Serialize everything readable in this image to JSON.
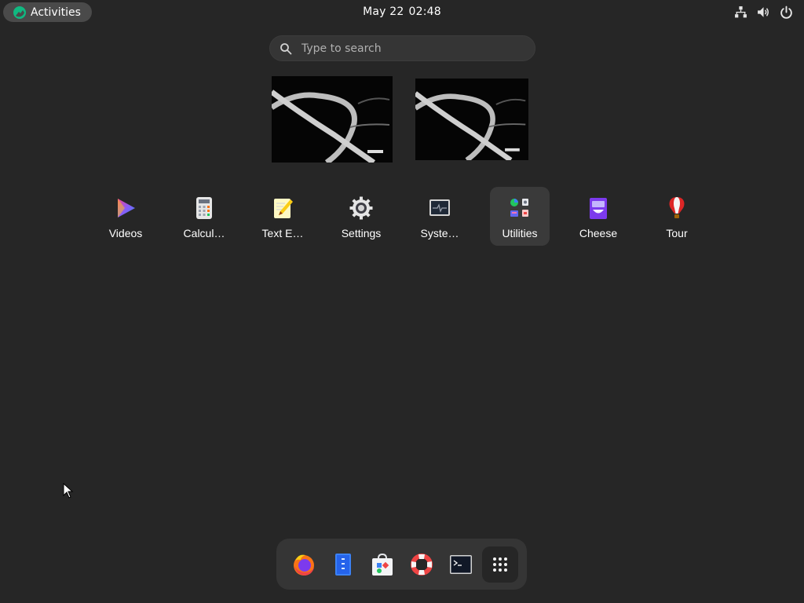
{
  "topbar": {
    "activities_label": "Activities",
    "clock_date": "May 22",
    "clock_time": "02:48",
    "tray_icons": [
      "network-wired-icon",
      "volume-icon",
      "power-icon"
    ]
  },
  "search": {
    "placeholder": "Type to search"
  },
  "workspaces": [
    {
      "name": "workspace-1"
    },
    {
      "name": "workspace-2"
    }
  ],
  "apps": [
    {
      "label": "Videos",
      "icon": "videos-icon"
    },
    {
      "label": "Calcul…",
      "icon": "calculator-icon"
    },
    {
      "label": "Text E…",
      "icon": "text-editor-icon"
    },
    {
      "label": "Settings",
      "icon": "settings-icon"
    },
    {
      "label": "Syste…",
      "icon": "system-monitor-icon"
    },
    {
      "label": "Utilities",
      "icon": "utilities-folder-icon",
      "selected": true
    },
    {
      "label": "Cheese",
      "icon": "cheese-icon"
    },
    {
      "label": "Tour",
      "icon": "tour-icon"
    }
  ],
  "dash": [
    "firefox-icon",
    "files-icon",
    "software-icon",
    "help-icon",
    "terminal-icon",
    "show-apps-icon"
  ],
  "colors": {
    "background": "#262626",
    "activities_bg": "#4a4a4a",
    "search_bg": "#353535",
    "selected_tile": "#3a3a3a",
    "dash_bg": "#353535",
    "rocky_green": "#10b981"
  }
}
